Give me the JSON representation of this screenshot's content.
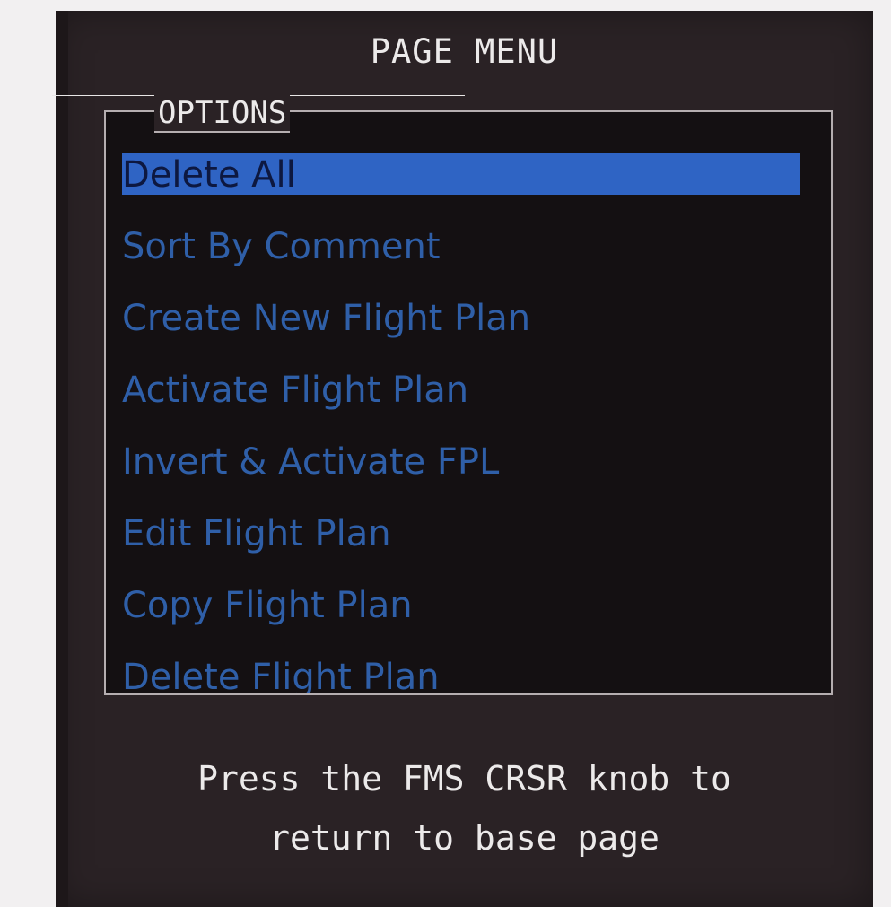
{
  "header": {
    "title": "PAGE MENU"
  },
  "options": {
    "label": "OPTIONS",
    "items": [
      {
        "label": "Delete All",
        "selected": true
      },
      {
        "label": "Sort By Comment",
        "selected": false
      },
      {
        "label": "Create New Flight Plan",
        "selected": false
      },
      {
        "label": "Activate Flight Plan",
        "selected": false
      },
      {
        "label": "Invert & Activate FPL",
        "selected": false
      },
      {
        "label": "Edit Flight Plan",
        "selected": false
      },
      {
        "label": "Copy Flight Plan",
        "selected": false
      },
      {
        "label": "Delete Flight Plan",
        "selected": false
      }
    ]
  },
  "footer": {
    "line1": "Press the FMS CRSR knob to",
    "line2": "return to base page"
  },
  "colors": {
    "panel_background": "#2a2225",
    "menu_text": "#2f5fa8",
    "selection_highlight": "#2f64c4",
    "title_text": "#eceaea"
  }
}
